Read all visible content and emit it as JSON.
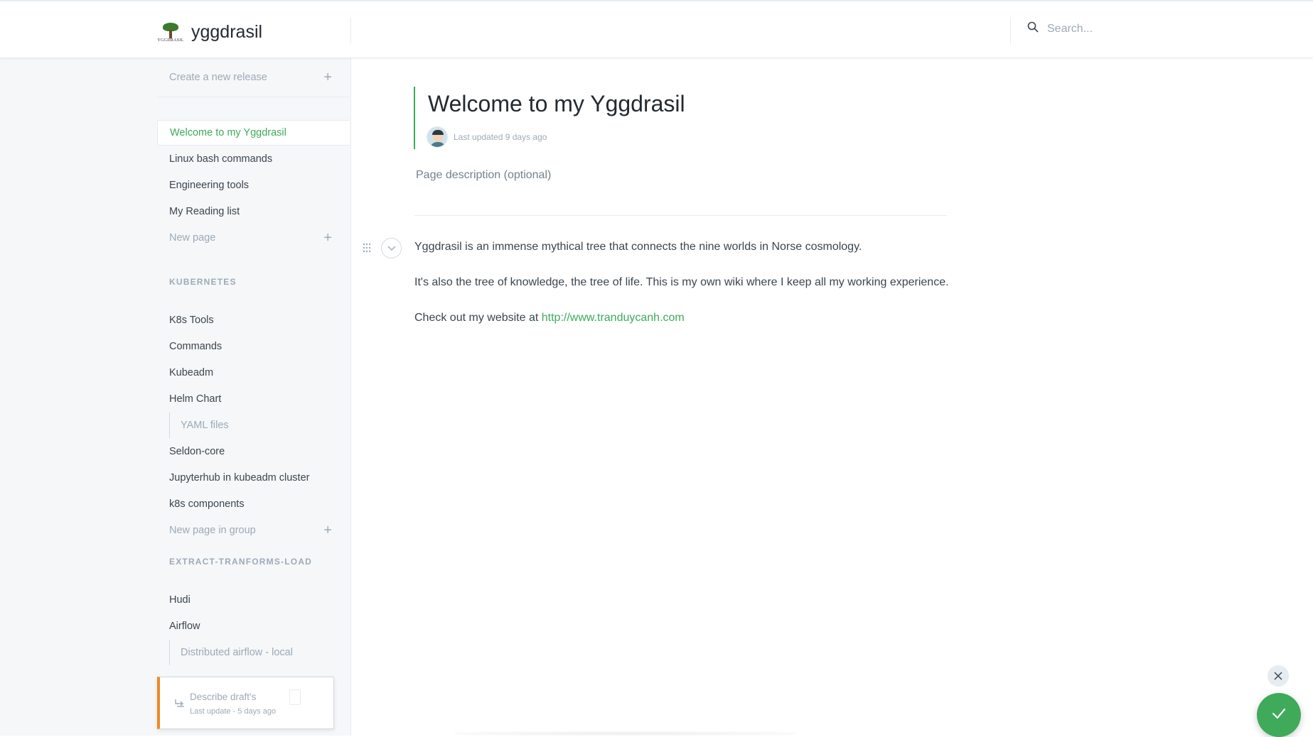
{
  "app": {
    "title": "yggdrasil",
    "logo_text": "YGGDRASIL"
  },
  "search": {
    "placeholder": "Search..."
  },
  "sidebar": {
    "create_release": "Create a new release",
    "pages": [
      {
        "label": "Welcome to my Yggdrasil",
        "active": true
      },
      {
        "label": "Linux bash commands"
      },
      {
        "label": "Engineering tools"
      },
      {
        "label": "My Reading list"
      }
    ],
    "new_page": "New page",
    "groups": [
      {
        "title": "KUBERNETES",
        "items": [
          {
            "label": "K8s Tools"
          },
          {
            "label": "Commands"
          },
          {
            "label": "Kubeadm"
          },
          {
            "label": "Helm Chart"
          },
          {
            "label": "YAML files",
            "sub": true
          },
          {
            "label": "Seldon-core"
          },
          {
            "label": "Jupyterhub in kubeadm cluster"
          },
          {
            "label": "k8s components"
          }
        ],
        "new_item": "New page in group"
      },
      {
        "title": "EXTRACT-TRANFORMS-LOAD",
        "items": [
          {
            "label": "Hudi"
          },
          {
            "label": "Airflow"
          },
          {
            "label": "Distributed airflow - local",
            "sub": true
          }
        ]
      }
    ],
    "draft": {
      "title": "Describe draft's",
      "updated": "Last update - 5 days ago"
    }
  },
  "page": {
    "title": "Welcome to my Yggdrasil",
    "updated": "Last updated 9 days ago",
    "description_placeholder": "Page description (optional)",
    "paragraphs": [
      "Yggdrasil is an immense mythical tree that connects the nine worlds in Norse cosmology.",
      "It's also the tree of knowledge, the tree of life. This is my own wiki where I keep all my working experience."
    ],
    "website_prefix": "Check out my website at ",
    "website_link": "http://www.tranduycanh.com"
  },
  "icons": {
    "search": "search-icon",
    "plus": "plus-icon",
    "drag": "drag-handle-icon",
    "collapse": "chevron-down-icon",
    "close": "close-icon",
    "check": "check-icon",
    "draft": "branch-icon"
  },
  "colors": {
    "accent": "#3eaa5a",
    "draft_accent": "#f08a24",
    "sidebar_bg": "#f5f7f9"
  }
}
